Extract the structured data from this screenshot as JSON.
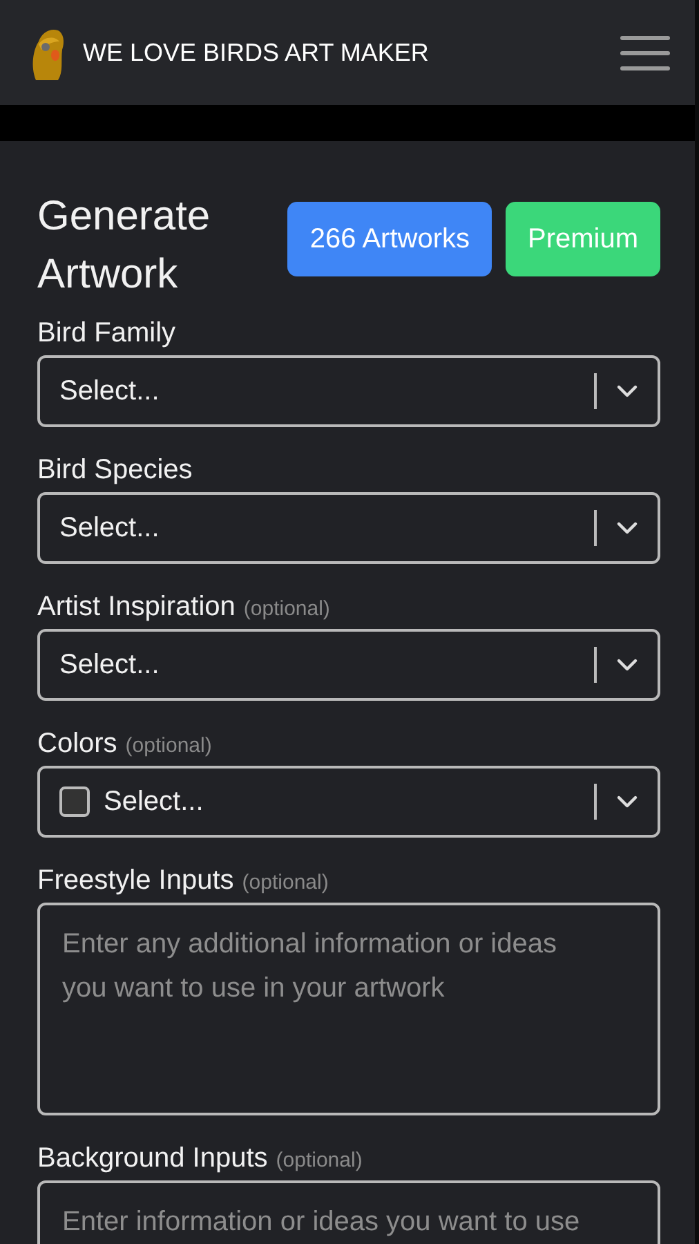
{
  "header": {
    "title": "WE LOVE BIRDS ART MAKER"
  },
  "heading": "Generate Artwork",
  "buttons": [
    {
      "label": "266 Artworks",
      "kind": "primary"
    },
    {
      "label": "Premium",
      "kind": "success"
    }
  ],
  "fields": [
    {
      "kind": "select",
      "label": "Bird Family",
      "placeholder": "Select..."
    },
    {
      "kind": "select",
      "label": "Bird Species",
      "placeholder": "Select..."
    },
    {
      "kind": "select",
      "label": "Artist Inspiration",
      "hint": "(optional)",
      "placeholder": "Select..."
    },
    {
      "kind": "select",
      "label": "Colors",
      "hint": "(optional)",
      "placeholder": "Select...",
      "checked": false
    },
    {
      "kind": "textarea",
      "label": "Freestyle Inputs",
      "hint": "(optional)",
      "placeholder": "Enter any additional information or ideas you want to use in your artwork"
    },
    {
      "kind": "textarea",
      "label": "Background Inputs",
      "hint": "(optional)",
      "placeholder": "Enter information or ideas you want to use"
    }
  ]
}
